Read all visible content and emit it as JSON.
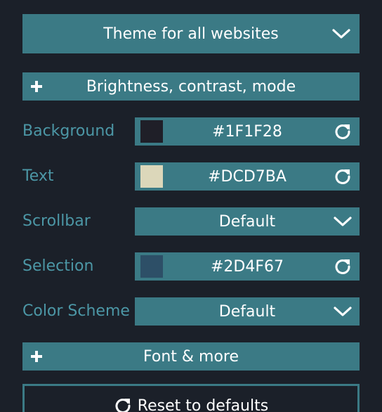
{
  "theme_dropdown": {
    "label": "Theme for all websites",
    "icon": "chevron-down-icon"
  },
  "brightness_section": {
    "label": "Brightness, contrast, mode",
    "icon": "plus-icon"
  },
  "rows": {
    "background": {
      "label": "Background",
      "value": "#1F1F28",
      "swatch_color": "#1F1F28",
      "icon": "reset-icon"
    },
    "text": {
      "label": "Text",
      "value": "#DCD7BA",
      "swatch_color": "#DCD7BA",
      "icon": "reset-icon"
    },
    "scrollbar": {
      "label": "Scrollbar",
      "value": "Default",
      "icon": "chevron-down-icon"
    },
    "selection": {
      "label": "Selection",
      "value": "#2D4F67",
      "swatch_color": "#2D4F67",
      "icon": "reset-icon"
    },
    "color_scheme": {
      "label": "Color Scheme",
      "value": "Default",
      "icon": "chevron-down-icon"
    }
  },
  "font_section": {
    "label": "Font & more",
    "icon": "plus-icon"
  },
  "reset_button": {
    "label": "Reset to defaults",
    "icon": "reset-icon"
  },
  "colors": {
    "page_background": "#1b2029",
    "accent": "#3b7a85",
    "label_text": "#4c97a6"
  }
}
